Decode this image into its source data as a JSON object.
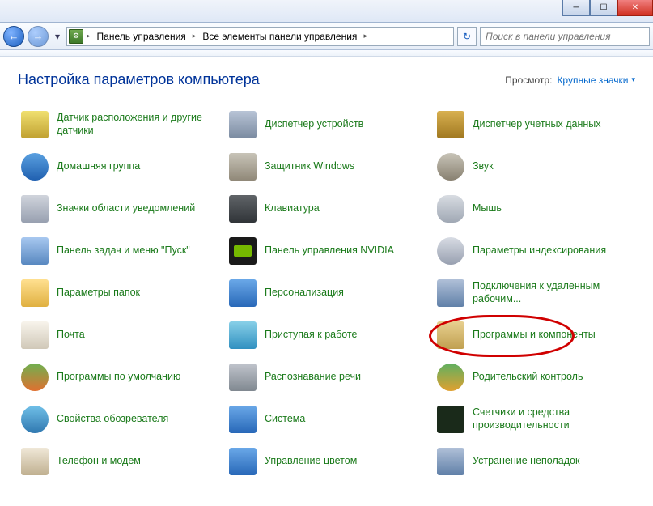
{
  "window": {
    "minimize": "─",
    "maximize": "☐",
    "close": "✕"
  },
  "nav": {
    "back_glyph": "←",
    "forward_glyph": "→",
    "dropdown_glyph": "▾",
    "refresh_glyph": "↻",
    "chevron": "▸"
  },
  "breadcrumb": {
    "seg1": "Панель управления",
    "seg2": "Все элементы панели управления"
  },
  "search": {
    "placeholder": "Поиск в панели управления"
  },
  "header": {
    "title": "Настройка параметров компьютера",
    "view_label": "Просмотр:",
    "view_value": "Крупные значки",
    "view_arrow": "▾"
  },
  "items": [
    {
      "label": "Датчик расположения и другие датчики",
      "icon": "ic-sensor"
    },
    {
      "label": "Диспетчер устройств",
      "icon": "ic-devmgr"
    },
    {
      "label": "Диспетчер учетных данных",
      "icon": "ic-creds"
    },
    {
      "label": "Домашняя группа",
      "icon": "ic-homegrp"
    },
    {
      "label": "Защитник Windows",
      "icon": "ic-defender"
    },
    {
      "label": "Звук",
      "icon": "ic-sound"
    },
    {
      "label": "Значки области уведомлений",
      "icon": "ic-tray"
    },
    {
      "label": "Клавиатура",
      "icon": "ic-keyboard"
    },
    {
      "label": "Мышь",
      "icon": "ic-mouse"
    },
    {
      "label": "Панель задач и меню \"Пуск\"",
      "icon": "ic-taskbar"
    },
    {
      "label": "Панель управления NVIDIA",
      "icon": "ic-nvidia"
    },
    {
      "label": "Параметры индексирования",
      "icon": "ic-index"
    },
    {
      "label": "Параметры папок",
      "icon": "ic-folder"
    },
    {
      "label": "Персонализация",
      "icon": "ic-personal"
    },
    {
      "label": "Подключения к удаленным рабочим...",
      "icon": "ic-remote"
    },
    {
      "label": "Почта",
      "icon": "ic-mail"
    },
    {
      "label": "Приступая к работе",
      "icon": "ic-getstart"
    },
    {
      "label": "Программы и компоненты",
      "icon": "ic-progs",
      "highlight": true
    },
    {
      "label": "Программы по умолчанию",
      "icon": "ic-defprogs"
    },
    {
      "label": "Распознавание речи",
      "icon": "ic-speech"
    },
    {
      "label": "Родительский контроль",
      "icon": "ic-parent"
    },
    {
      "label": "Свойства обозревателя",
      "icon": "ic-inet"
    },
    {
      "label": "Система",
      "icon": "ic-system"
    },
    {
      "label": "Счетчики и средства производительности",
      "icon": "ic-perf"
    },
    {
      "label": "Телефон и модем",
      "icon": "ic-phone"
    },
    {
      "label": "Управление цветом",
      "icon": "ic-color"
    },
    {
      "label": "Устранение неполадок",
      "icon": "ic-trouble"
    }
  ]
}
